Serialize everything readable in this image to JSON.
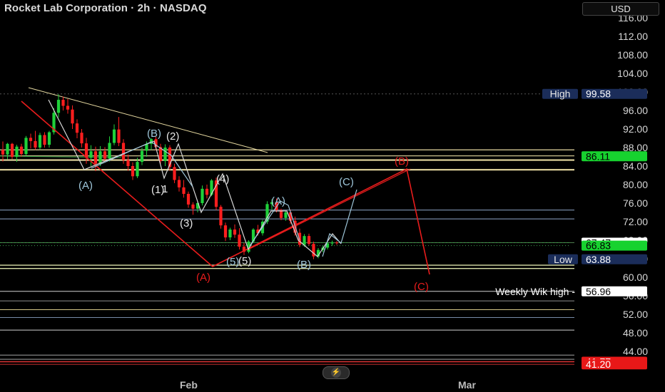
{
  "header": {
    "title": "Rocket Lab Corporation · 2h · NASDAQ",
    "currency": "USD"
  },
  "chart_data": {
    "type": "candlestick",
    "y_ticks": [
      "116.00",
      "112.00",
      "108.00",
      "104.00",
      "100.00",
      "96.00",
      "92.00",
      "88.00",
      "84.00",
      "80.00",
      "76.00",
      "72.00",
      "68.00",
      "64.00",
      "60.00",
      "56.00",
      "52.00",
      "48.00",
      "44.00"
    ],
    "x_ticks": [
      "Feb",
      "Mar"
    ],
    "price_tags": [
      {
        "label": "High",
        "value": "99.58",
        "style": "navy"
      },
      {
        "value": "86.11",
        "style": "green"
      },
      {
        "value": "67.47",
        "style": "white"
      },
      {
        "value": "66.83",
        "style": "green"
      },
      {
        "label": "Low",
        "value": "63.88",
        "style": "navy"
      },
      {
        "label": "Weekly Wik high -",
        "value": "56.96",
        "style": "white"
      },
      {
        "value": "41.77",
        "style": "red"
      },
      {
        "value": "41.20",
        "style": "red"
      }
    ],
    "wave_labels": {
      "blue": [
        "(A)",
        "(B)",
        "(C)",
        "(A)",
        "(B)",
        "(5)"
      ],
      "white": [
        "(2)",
        "1",
        "(1)",
        "(3)",
        "(4)",
        "(5)"
      ],
      "red": [
        "(A)",
        "(B)",
        "(C)"
      ]
    },
    "candles": [
      [
        87.5,
        89.3,
        85.0,
        86.5
      ],
      [
        86.5,
        89.0,
        85.5,
        88.8
      ],
      [
        88.8,
        89.0,
        85.5,
        86.0
      ],
      [
        86.0,
        88.6,
        84.9,
        88.2
      ],
      [
        88.2,
        88.8,
        86.0,
        86.6
      ],
      [
        86.6,
        90.5,
        86.2,
        90.1
      ],
      [
        90.1,
        91.0,
        87.8,
        89.4
      ],
      [
        89.4,
        91.6,
        87.5,
        88.0
      ],
      [
        88.0,
        91.2,
        87.5,
        90.7
      ],
      [
        90.7,
        91.3,
        88.0,
        88.6
      ],
      [
        88.6,
        91.6,
        88.0,
        91.3
      ],
      [
        91.3,
        96.5,
        90.8,
        95.5
      ],
      [
        95.5,
        99.5,
        94.5,
        98.3
      ],
      [
        98.3,
        99.0,
        96.0,
        97.0
      ],
      [
        97.0,
        98.5,
        95.3,
        96.2
      ],
      [
        96.2,
        97.1,
        92.0,
        93.2
      ],
      [
        93.2,
        94.1,
        90.0,
        91.2
      ],
      [
        91.2,
        92.0,
        88.0,
        88.9
      ],
      [
        88.9,
        90.1,
        84.5,
        85.8
      ],
      [
        85.8,
        88.5,
        84.0,
        87.2
      ],
      [
        87.2,
        88.2,
        82.9,
        84.5
      ],
      [
        84.5,
        88.3,
        84.0,
        87.2
      ],
      [
        87.2,
        88.1,
        85.0,
        85.6
      ],
      [
        85.6,
        90.4,
        85.0,
        89.0
      ],
      [
        89.0,
        93.0,
        88.5,
        91.9
      ],
      [
        91.9,
        94.6,
        88.3,
        89.0
      ],
      [
        89.0,
        89.8,
        84.5,
        85.3
      ],
      [
        85.3,
        86.5,
        83.0,
        84.0
      ],
      [
        84.0,
        84.8,
        81.0,
        81.8
      ],
      [
        81.8,
        85.8,
        81.4,
        84.9
      ],
      [
        84.9,
        88.0,
        84.2,
        87.3
      ],
      [
        87.3,
        89.3,
        86.0,
        88.8
      ],
      [
        88.8,
        90.0,
        87.5,
        89.8
      ],
      [
        89.8,
        90.3,
        87.4,
        88.1
      ],
      [
        88.1,
        88.8,
        84.5,
        85.1
      ],
      [
        85.1,
        88.7,
        84.0,
        88.0
      ],
      [
        88.0,
        88.5,
        83.0,
        83.8
      ],
      [
        83.8,
        84.5,
        80.3,
        81.0
      ],
      [
        81.0,
        81.8,
        78.5,
        79.4
      ],
      [
        79.4,
        81.0,
        77.2,
        78.0
      ],
      [
        78.0,
        78.5,
        75.0,
        75.7
      ],
      [
        75.7,
        76.2,
        73.5,
        74.8
      ],
      [
        74.8,
        76.4,
        74.0,
        76.0
      ],
      [
        76.0,
        79.8,
        75.5,
        79.1
      ],
      [
        79.1,
        80.0,
        77.0,
        77.8
      ],
      [
        77.8,
        81.2,
        77.5,
        80.9
      ],
      [
        80.9,
        81.5,
        74.5,
        75.2
      ],
      [
        75.2,
        75.6,
        70.5,
        71.2
      ],
      [
        71.2,
        71.8,
        67.8,
        68.6
      ],
      [
        68.6,
        70.7,
        68.0,
        70.3
      ],
      [
        70.3,
        71.4,
        68.5,
        69.2
      ],
      [
        69.2,
        70.6,
        66.0,
        66.6
      ],
      [
        66.6,
        67.4,
        64.8,
        65.5
      ],
      [
        65.5,
        68.0,
        65.2,
        67.7
      ],
      [
        67.7,
        70.6,
        67.4,
        70.3
      ],
      [
        70.3,
        71.3,
        69.0,
        69.5
      ],
      [
        69.5,
        72.4,
        69.0,
        72.0
      ],
      [
        72.0,
        76.4,
        71.5,
        75.8
      ],
      [
        75.8,
        76.8,
        74.5,
        76.2
      ],
      [
        76.2,
        77.0,
        74.0,
        74.5
      ],
      [
        74.5,
        74.8,
        72.3,
        72.8
      ],
      [
        72.8,
        74.3,
        72.2,
        74.0
      ],
      [
        74.0,
        74.6,
        71.5,
        72.2
      ],
      [
        72.2,
        73.1,
        69.0,
        69.6
      ],
      [
        69.6,
        70.5,
        66.5,
        67.0
      ],
      [
        67.0,
        69.3,
        66.6,
        68.9
      ],
      [
        68.9,
        69.4,
        66.8,
        67.2
      ],
      [
        67.2,
        67.7,
        63.9,
        64.5
      ],
      [
        64.5,
        66.3,
        64.1,
        65.9
      ],
      [
        65.9,
        66.8,
        65.4,
        66.4
      ],
      [
        66.4,
        67.8,
        66.0,
        67.3
      ],
      [
        67.3,
        67.9,
        66.8,
        67.5
      ],
      [
        67.5,
        67.8,
        67.0,
        67.47
      ]
    ],
    "ylim": [
      40.0,
      117.5
    ]
  }
}
